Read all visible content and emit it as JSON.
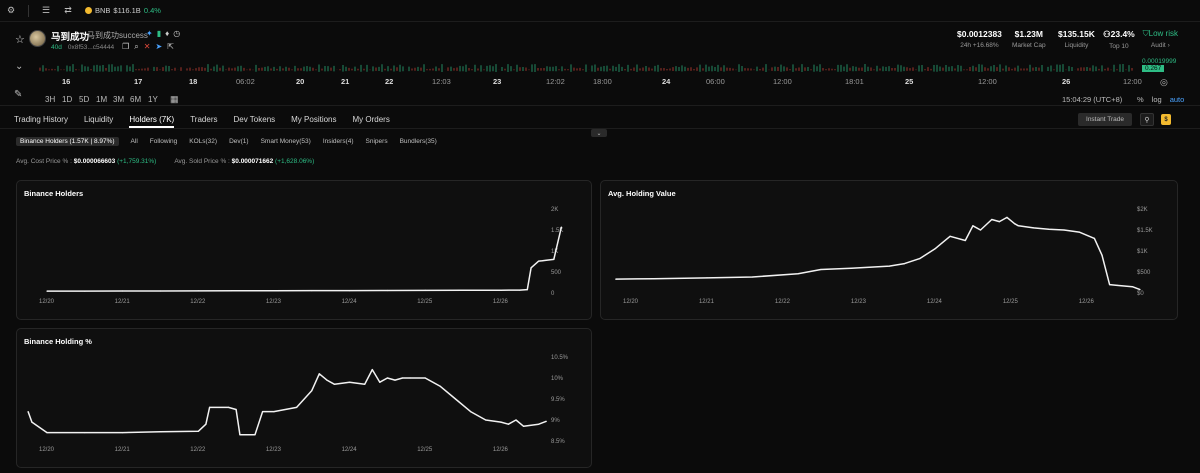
{
  "topbar": {
    "bnb_label": "BNB",
    "bnb_price": "$116.1B",
    "bnb_change": "0.4%"
  },
  "token": {
    "name": "马到成功",
    "subtitle": "马到成功success",
    "age": "40d",
    "address": "0x8f53...c54444",
    "stats": [
      {
        "value": "$0.0012383",
        "label": "24h +16.68%"
      },
      {
        "value": "$1.23M",
        "label": "Market Cap"
      },
      {
        "value": "$135.15K",
        "label": "Liquidity"
      },
      {
        "value": "23.4%",
        "label": "Top 10"
      }
    ],
    "risk": {
      "value": "Low risk",
      "label": "Audit"
    }
  },
  "price_strip": {
    "dates": [
      "16",
      "17",
      "18",
      "06:02",
      "20",
      "21",
      "22",
      "12:03",
      "23",
      "12:02",
      "18:00",
      "24",
      "06:00",
      "12:00",
      "18:01",
      "25",
      "12:00",
      "26",
      "12:00"
    ],
    "price_top": "0.00019999",
    "price_badge": "0.267",
    "timeframes": [
      "3H",
      "1D",
      "5D",
      "1M",
      "3M",
      "6M",
      "1Y"
    ],
    "time": "15:04:29 (UTC+8)",
    "pct": "%",
    "log": "log",
    "auto": "auto"
  },
  "tabs": [
    "Trading History",
    "Liquidity",
    "Holders (7K)",
    "Traders",
    "Dev Tokens",
    "My Positions",
    "My Orders"
  ],
  "instant_trade": "Instant Trade",
  "filters": [
    "Binance Holders (1.57K | 8.97%)",
    "All",
    "Following",
    "KOLs(32)",
    "Dev(1)",
    "Smart Money(53)",
    "Insiders(4)",
    "Snipers",
    "Bundlers(35)"
  ],
  "avg": {
    "cost_label": "Avg. Cost Price",
    "cost_value": "$0.000066603",
    "cost_change": "(+1,759.31%)",
    "sold_label": "Avg. Sold Price",
    "sold_value": "$0.000071662",
    "sold_change": "(+1,628.06%)"
  },
  "chart_data": [
    {
      "type": "line",
      "title": "Binance Holders",
      "x_ticks": [
        "12/20",
        "12/21",
        "12/22",
        "12/23",
        "12/24",
        "12/25",
        "12/26"
      ],
      "y_ticks": [
        "0",
        "500",
        "1K",
        "1.5K",
        "2K"
      ],
      "ylim": [
        0,
        2000
      ],
      "x": [
        0,
        0.5,
        1,
        1.5,
        2,
        2.5,
        3,
        3.5,
        4,
        4.5,
        5,
        5.5,
        6,
        6.25,
        6.35,
        6.4,
        6.5,
        6.55,
        6.6,
        6.7,
        6.8
      ],
      "values": [
        45,
        46,
        47,
        48,
        50,
        52,
        54,
        56,
        58,
        60,
        62,
        64,
        66,
        70,
        80,
        600,
        760,
        770,
        780,
        800,
        1570
      ]
    },
    {
      "type": "line",
      "title": "Avg. Holding Value",
      "x_ticks": [
        "12/20",
        "12/21",
        "12/22",
        "12/23",
        "12/24",
        "12/25",
        "12/26"
      ],
      "y_ticks": [
        "$0",
        "$500",
        "$1K",
        "$1.5K",
        "$2K"
      ],
      "ylim": [
        0,
        2000
      ],
      "x": [
        -0.2,
        0.3,
        1,
        1.6,
        2.2,
        2.5,
        2.9,
        3.4,
        3.6,
        3.8,
        4,
        4.1,
        4.2,
        4.4,
        4.5,
        4.6,
        4.75,
        4.85,
        4.95,
        5.05,
        5.1,
        5.3,
        5.5,
        5.7,
        5.9,
        6.1,
        6.2,
        6.3,
        6.4,
        6.6,
        6.7
      ],
      "values": [
        330,
        340,
        360,
        380,
        460,
        560,
        590,
        640,
        700,
        820,
        1050,
        1200,
        1350,
        1250,
        1600,
        1500,
        1750,
        1700,
        1800,
        1650,
        1600,
        1550,
        1520,
        1500,
        1450,
        1300,
        900,
        200,
        180,
        150,
        80
      ]
    },
    {
      "type": "line",
      "title": "Binance Holding %",
      "x_ticks": [
        "12/20",
        "12/21",
        "12/22",
        "12/23",
        "12/24",
        "12/25",
        "12/26"
      ],
      "y_ticks": [
        "8.5%",
        "9%",
        "9.5%",
        "10%",
        "10.5%"
      ],
      "ylim": [
        8.5,
        10.5
      ],
      "x": [
        -0.25,
        -0.2,
        0,
        0.5,
        1,
        1.5,
        2,
        2.1,
        2.15,
        2.4,
        2.5,
        2.55,
        2.75,
        2.85,
        3,
        3.3,
        3.5,
        3.6,
        3.7,
        3.8,
        4,
        4.2,
        4.3,
        4.4,
        4.5,
        4.6,
        4.7,
        4.8,
        5,
        5.2,
        5.4,
        5.6,
        5.8,
        6,
        6.1,
        6.2,
        6.3,
        6.5,
        6.6
      ],
      "values": [
        9.2,
        8.95,
        8.7,
        8.7,
        8.7,
        8.72,
        8.73,
        8.9,
        9.3,
        9.3,
        9.25,
        8.65,
        8.65,
        9.2,
        9.2,
        9.3,
        9.7,
        10.1,
        9.95,
        9.85,
        9.9,
        9.85,
        10.2,
        9.9,
        10.0,
        9.95,
        10.0,
        10.0,
        10.0,
        9.8,
        9.5,
        9.2,
        9.0,
        8.95,
        8.9,
        9.0,
        8.85,
        8.9,
        8.97
      ]
    }
  ]
}
